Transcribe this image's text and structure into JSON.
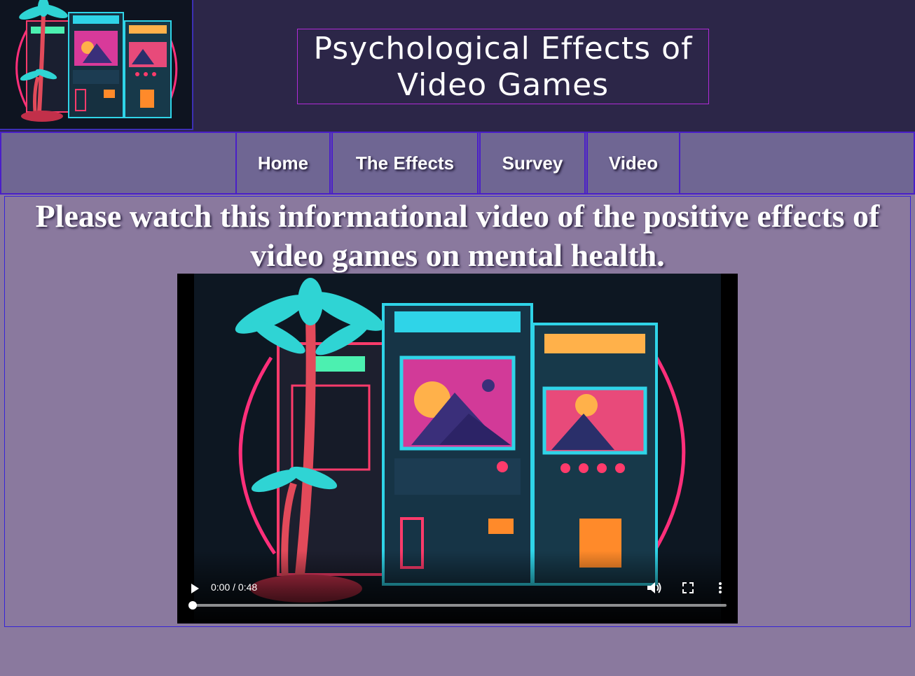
{
  "header": {
    "logo_name": "retro-arcade-logo-image",
    "title_line1": "Psychological Effects of",
    "title_line2": "Video Games"
  },
  "nav": {
    "items": [
      {
        "label": "Home"
      },
      {
        "label": "The Effects"
      },
      {
        "label": "Survey"
      },
      {
        "label": "Video"
      }
    ]
  },
  "main": {
    "heading": "Please watch this informational video of the positive effects of video games on mental health.",
    "video": {
      "time_display": "0:00 / 0:48",
      "progress": 0,
      "play_icon": "play-icon",
      "volume_icon": "volume-icon",
      "fullscreen_icon": "fullscreen-icon",
      "more_icon": "more-options-icon"
    }
  },
  "colors": {
    "header_bg": "#2c2648",
    "nav_bg": "#6f6693",
    "page_bg": "#8a799e",
    "border_blue": "#4a1fc8",
    "title_border": "#b12bd8"
  }
}
